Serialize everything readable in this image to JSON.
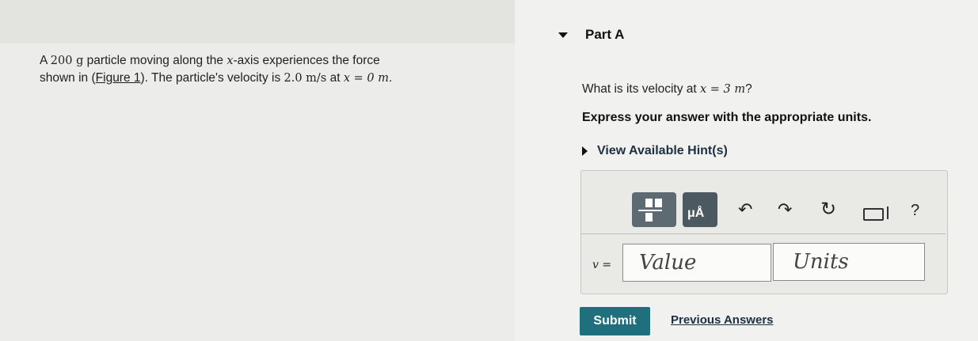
{
  "problem": {
    "text_1": "A ",
    "mass": "200 g",
    "text_2": " particle moving along the ",
    "axis_var": "x",
    "text_3": "-axis experiences the force",
    "text_4": "shown in (",
    "figure_link": "Figure 1",
    "text_5": "). The particle's velocity is ",
    "velocity": "2.0 m/s",
    "text_6": " at ",
    "position": "x = 0 m",
    "text_7": "."
  },
  "part": {
    "title": "Part A",
    "question_1": "What is its velocity at ",
    "question_math": "x = 3 m",
    "question_2": "?",
    "instructions": "Express your answer with the appropriate units.",
    "hints_label": "View Available Hint(s)"
  },
  "toolbar": {
    "symbols_label": "μÅ",
    "undo_icon": "↶",
    "redo_icon": "↷",
    "reset_icon": "↻",
    "help_label": "?"
  },
  "answer": {
    "variable_label": "v =",
    "value_placeholder": "Value",
    "units_placeholder": "Units"
  },
  "actions": {
    "submit_label": "Submit",
    "previous_answers_label": "Previous Answers"
  },
  "colors": {
    "submit": "#1f6f7d",
    "toolbar_button": "#5e6a72"
  }
}
